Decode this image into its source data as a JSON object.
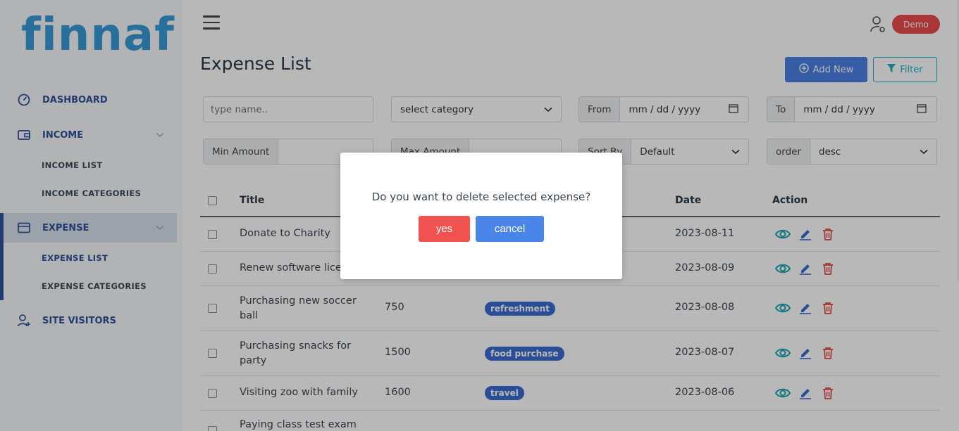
{
  "brand": {
    "logo": "finnaf"
  },
  "sidebar": {
    "items": [
      {
        "label": "DASHBOARD",
        "icon": "dashboard-icon"
      },
      {
        "label": "INCOME",
        "icon": "wallet-icon"
      },
      {
        "label": "EXPENSE",
        "icon": "card-icon"
      },
      {
        "label": "SITE VISITORS",
        "icon": "user-plus-icon"
      }
    ],
    "income_sub": [
      "INCOME LIST",
      "INCOME CATEGORIES"
    ],
    "expense_sub": [
      "EXPENSE LIST",
      "EXPENSE CATEGORIES"
    ]
  },
  "header": {
    "user_badge": "Demo"
  },
  "page": {
    "title": "Expense List",
    "add_new": "Add New",
    "filter": "Filter"
  },
  "filters": {
    "name_placeholder": "type name..",
    "category": "select category",
    "from_label": "From",
    "from_value": "mm / dd / yyyy",
    "to_label": "To",
    "to_value": "mm / dd / yyyy",
    "min_amount_label": "Min Amount",
    "max_amount_label": "Max Amount",
    "sort_by_label": "Sort By",
    "sort_by_value": "Default",
    "order_label": "order",
    "order_value": "desc"
  },
  "table": {
    "headers": {
      "title": "Title",
      "date": "Date",
      "action": "Action"
    },
    "rows": [
      {
        "title": "Donate to Charity",
        "amount": "",
        "category": "",
        "date": "2023-08-11"
      },
      {
        "title": "Renew software lice",
        "amount": "",
        "category": "",
        "date": "2023-08-09"
      },
      {
        "title": "Purchasing new soccer ball",
        "amount": "750",
        "category": "refreshment",
        "date": "2023-08-08"
      },
      {
        "title": "Purchasing snacks for party",
        "amount": "1500",
        "category": "food purchase",
        "date": "2023-08-07"
      },
      {
        "title": "Visiting zoo with family",
        "amount": "1600",
        "category": "travel",
        "date": "2023-08-06"
      },
      {
        "title": "Paying class test exam",
        "amount": "",
        "category": "",
        "date": ""
      }
    ]
  },
  "modal": {
    "message": "Do you want to delete selected expense?",
    "yes": "yes",
    "cancel": "cancel"
  },
  "colors": {
    "primary": "#31539b",
    "logo": "#3a9ad9",
    "danger": "#f0524f",
    "button_blue": "#4a86e8",
    "teal": "#1ab3c4"
  }
}
